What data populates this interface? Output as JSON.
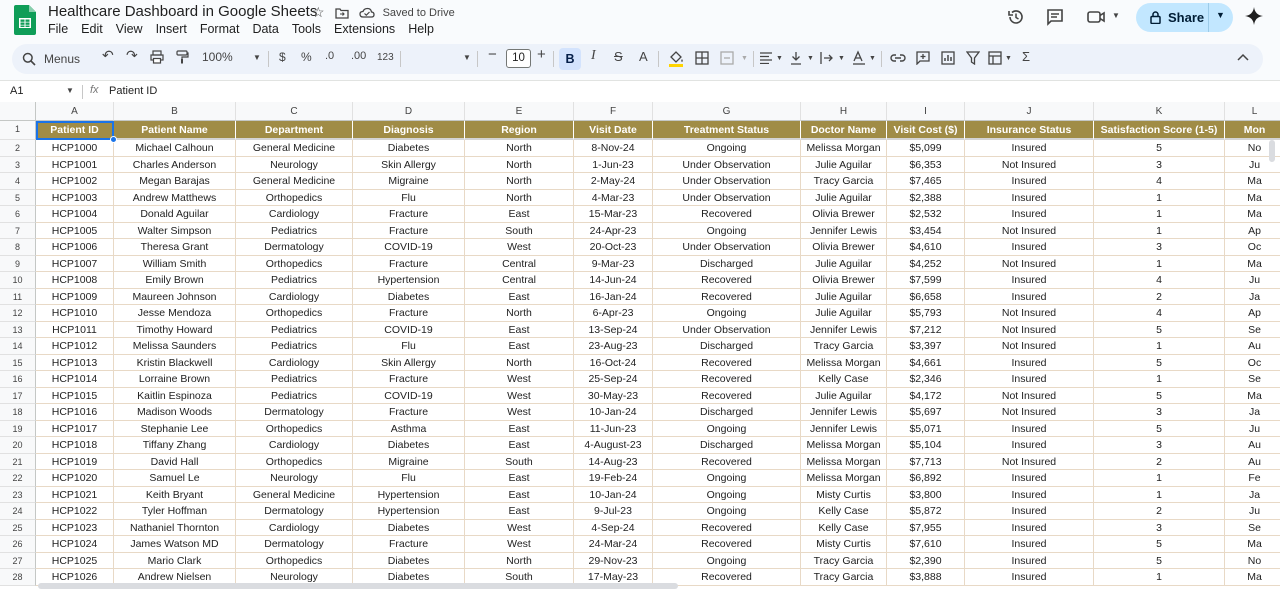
{
  "app": {
    "title": "Healthcare Dashboard in Google Sheets",
    "saved_status": "Saved to Drive",
    "share_label": "Share",
    "menus": [
      "File",
      "Edit",
      "View",
      "Insert",
      "Format",
      "Data",
      "Tools",
      "Extensions",
      "Help"
    ]
  },
  "toolbar": {
    "search_label": "Menus",
    "zoom": "100%",
    "currency": "$",
    "percent": "%",
    "dec_decrease": ".0",
    "dec_increase": ".00",
    "number_format": "123",
    "font_size": "10",
    "bold": "B",
    "italic": "I",
    "strike": "S",
    "text_color": "A",
    "sum": "Σ"
  },
  "formula_bar": {
    "cell_ref": "A1",
    "fx": "fx",
    "content": "Patient ID"
  },
  "colors": {
    "header_bg": "#a08c46",
    "selection": "#1a73e8",
    "share_bg": "#c2e7ff",
    "toolbar_bg": "#edf2fa"
  },
  "columns": [
    "A",
    "B",
    "C",
    "D",
    "E",
    "F",
    "G",
    "H",
    "I",
    "J",
    "K",
    "L"
  ],
  "headers": [
    "Patient ID",
    "Patient Name",
    "Department",
    "Diagnosis",
    "Region",
    "Visit Date",
    "Treatment Status",
    "Doctor Name",
    "Visit Cost ($)",
    "Insurance Status",
    "Satisfaction Score (1-5)",
    "Mon"
  ],
  "rows": [
    [
      "HCP1000",
      "Michael Calhoun",
      "General Medicine",
      "Diabetes",
      "North",
      "8-Nov-24",
      "Ongoing",
      "Melissa Morgan",
      "$5,099",
      "Insured",
      "5",
      "No"
    ],
    [
      "HCP1001",
      "Charles Anderson",
      "Neurology",
      "Skin Allergy",
      "North",
      "1-Jun-23",
      "Under Observation",
      "Julie Aguilar",
      "$6,353",
      "Not Insured",
      "3",
      "Ju"
    ],
    [
      "HCP1002",
      "Megan Barajas",
      "General Medicine",
      "Migraine",
      "North",
      "2-May-24",
      "Under Observation",
      "Tracy Garcia",
      "$7,465",
      "Insured",
      "4",
      "Ma"
    ],
    [
      "HCP1003",
      "Andrew Matthews",
      "Orthopedics",
      "Flu",
      "North",
      "4-Mar-23",
      "Under Observation",
      "Julie Aguilar",
      "$2,388",
      "Insured",
      "1",
      "Ma"
    ],
    [
      "HCP1004",
      "Donald Aguilar",
      "Cardiology",
      "Fracture",
      "East",
      "15-Mar-23",
      "Recovered",
      "Olivia Brewer",
      "$2,532",
      "Insured",
      "1",
      "Ma"
    ],
    [
      "HCP1005",
      "Walter Simpson",
      "Pediatrics",
      "Fracture",
      "South",
      "24-Apr-23",
      "Ongoing",
      "Jennifer Lewis",
      "$3,454",
      "Not Insured",
      "1",
      "Ap"
    ],
    [
      "HCP1006",
      "Theresa Grant",
      "Dermatology",
      "COVID-19",
      "West",
      "20-Oct-23",
      "Under Observation",
      "Olivia Brewer",
      "$4,610",
      "Insured",
      "3",
      "Oc"
    ],
    [
      "HCP1007",
      "William Smith",
      "Orthopedics",
      "Fracture",
      "Central",
      "9-Mar-23",
      "Discharged",
      "Julie Aguilar",
      "$4,252",
      "Not Insured",
      "1",
      "Ma"
    ],
    [
      "HCP1008",
      "Emily Brown",
      "Pediatrics",
      "Hypertension",
      "Central",
      "14-Jun-24",
      "Recovered",
      "Olivia Brewer",
      "$7,599",
      "Insured",
      "4",
      "Ju"
    ],
    [
      "HCP1009",
      "Maureen Johnson",
      "Cardiology",
      "Diabetes",
      "East",
      "16-Jan-24",
      "Recovered",
      "Julie Aguilar",
      "$6,658",
      "Insured",
      "2",
      "Ja"
    ],
    [
      "HCP1010",
      "Jesse Mendoza",
      "Orthopedics",
      "Fracture",
      "North",
      "6-Apr-23",
      "Ongoing",
      "Julie Aguilar",
      "$5,793",
      "Not Insured",
      "4",
      "Ap"
    ],
    [
      "HCP1011",
      "Timothy Howard",
      "Pediatrics",
      "COVID-19",
      "East",
      "13-Sep-24",
      "Under Observation",
      "Jennifer Lewis",
      "$7,212",
      "Not Insured",
      "5",
      "Se"
    ],
    [
      "HCP1012",
      "Melissa Saunders",
      "Pediatrics",
      "Flu",
      "East",
      "23-Aug-23",
      "Discharged",
      "Tracy Garcia",
      "$3,397",
      "Not Insured",
      "1",
      "Au"
    ],
    [
      "HCP1013",
      "Kristin Blackwell",
      "Cardiology",
      "Skin Allergy",
      "North",
      "16-Oct-24",
      "Recovered",
      "Melissa Morgan",
      "$4,661",
      "Insured",
      "5",
      "Oc"
    ],
    [
      "HCP1014",
      "Lorraine Brown",
      "Pediatrics",
      "Fracture",
      "West",
      "25-Sep-24",
      "Recovered",
      "Kelly Case",
      "$2,346",
      "Insured",
      "1",
      "Se"
    ],
    [
      "HCP1015",
      "Kaitlin Espinoza",
      "Pediatrics",
      "COVID-19",
      "West",
      "30-May-23",
      "Recovered",
      "Julie Aguilar",
      "$4,172",
      "Not Insured",
      "5",
      "Ma"
    ],
    [
      "HCP1016",
      "Madison Woods",
      "Dermatology",
      "Fracture",
      "West",
      "10-Jan-24",
      "Discharged",
      "Jennifer Lewis",
      "$5,697",
      "Not Insured",
      "3",
      "Ja"
    ],
    [
      "HCP1017",
      "Stephanie Lee",
      "Orthopedics",
      "Asthma",
      "East",
      "11-Jun-23",
      "Ongoing",
      "Jennifer Lewis",
      "$5,071",
      "Insured",
      "5",
      "Ju"
    ],
    [
      "HCP1018",
      "Tiffany Zhang",
      "Cardiology",
      "Diabetes",
      "East",
      "4-August-23",
      "Discharged",
      "Melissa Morgan",
      "$5,104",
      "Insured",
      "3",
      "Au"
    ],
    [
      "HCP1019",
      "David Hall",
      "Orthopedics",
      "Migraine",
      "South",
      "14-Aug-23",
      "Recovered",
      "Melissa Morgan",
      "$7,713",
      "Not Insured",
      "2",
      "Au"
    ],
    [
      "HCP1020",
      "Samuel Le",
      "Neurology",
      "Flu",
      "East",
      "19-Feb-24",
      "Ongoing",
      "Melissa Morgan",
      "$6,892",
      "Insured",
      "1",
      "Fe"
    ],
    [
      "HCP1021",
      "Keith Bryant",
      "General Medicine",
      "Hypertension",
      "East",
      "10-Jan-24",
      "Ongoing",
      "Misty Curtis",
      "$3,800",
      "Insured",
      "1",
      "Ja"
    ],
    [
      "HCP1022",
      "Tyler Hoffman",
      "Dermatology",
      "Hypertension",
      "East",
      "9-Jul-23",
      "Ongoing",
      "Kelly Case",
      "$5,872",
      "Insured",
      "2",
      "Ju"
    ],
    [
      "HCP1023",
      "Nathaniel Thornton",
      "Cardiology",
      "Diabetes",
      "West",
      "4-Sep-24",
      "Recovered",
      "Kelly Case",
      "$7,955",
      "Insured",
      "3",
      "Se"
    ],
    [
      "HCP1024",
      "James Watson MD",
      "Dermatology",
      "Fracture",
      "West",
      "24-Mar-24",
      "Recovered",
      "Misty Curtis",
      "$7,610",
      "Insured",
      "5",
      "Ma"
    ],
    [
      "HCP1025",
      "Mario Clark",
      "Orthopedics",
      "Diabetes",
      "North",
      "29-Nov-23",
      "Ongoing",
      "Tracy Garcia",
      "$2,390",
      "Insured",
      "5",
      "No"
    ],
    [
      "HCP1026",
      "Andrew Nielsen",
      "Neurology",
      "Diabetes",
      "South",
      "17-May-23",
      "Recovered",
      "Tracy Garcia",
      "$3,888",
      "Insured",
      "1",
      "Ma"
    ]
  ]
}
